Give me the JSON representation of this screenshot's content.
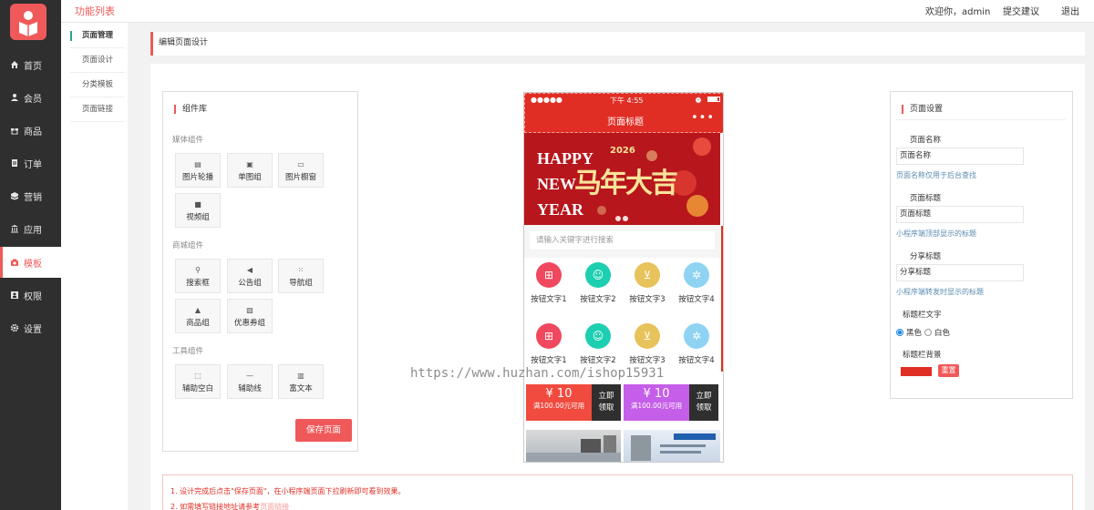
{
  "header": {
    "title": "功能列表",
    "welcome": "欢迎你，admin",
    "feedback": "提交建议",
    "logout": "退出"
  },
  "sidebar": {
    "items": [
      {
        "label": "首页",
        "icon": "home-icon"
      },
      {
        "label": "会员",
        "icon": "user-icon"
      },
      {
        "label": "商品",
        "icon": "gift-icon"
      },
      {
        "label": "订单",
        "icon": "order-icon"
      },
      {
        "label": "营销",
        "icon": "marketing-icon"
      },
      {
        "label": "应用",
        "icon": "bank-icon"
      },
      {
        "label": "模板",
        "icon": "camera-icon",
        "active": true
      },
      {
        "label": "权限",
        "icon": "permission-icon"
      },
      {
        "label": "设置",
        "icon": "gear-icon"
      }
    ]
  },
  "subnav": {
    "items": [
      "页面管理",
      "页面设计",
      "分类模板",
      "页面链接"
    ]
  },
  "page": {
    "heading": "编辑页面设计"
  },
  "library": {
    "title": "组件库",
    "groups": [
      {
        "label": "媒体组件",
        "items": [
          {
            "label": "图片轮播",
            "icon": "image-carousel-icon"
          },
          {
            "label": "单图组",
            "icon": "image-icon"
          },
          {
            "label": "图片橱窗",
            "icon": "window-icon"
          },
          {
            "label": "视频组",
            "icon": "video-icon"
          }
        ]
      },
      {
        "label": "商城组件",
        "items": [
          {
            "label": "搜索框",
            "icon": "search-icon"
          },
          {
            "label": "公告组",
            "icon": "announcement-icon"
          },
          {
            "label": "导航组",
            "icon": "grid-icon"
          },
          {
            "label": "商品组",
            "icon": "bag-icon"
          },
          {
            "label": "优惠券组",
            "icon": "coupon-icon"
          }
        ]
      },
      {
        "label": "工具组件",
        "items": [
          {
            "label": "辅助空白",
            "icon": "blank-icon"
          },
          {
            "label": "辅助线",
            "icon": "line-icon"
          },
          {
            "label": "富文本",
            "icon": "clipboard-icon"
          }
        ]
      }
    ],
    "save_label": "保存页面"
  },
  "phone": {
    "status_signal": "●●●●●",
    "status_time": "下午 4:55",
    "title": "页面标题",
    "menu": "•••",
    "banner": {
      "line1": "HAPPY",
      "line2": "NEW",
      "line3": "YEAR",
      "main": "马年大吉",
      "year": "2026"
    },
    "search_placeholder": "请输入关键字进行搜索",
    "nav_buttons": [
      {
        "label": "按钮文字1",
        "color": "#f0485e"
      },
      {
        "label": "按钮文字2",
        "color": "#1ccfb0"
      },
      {
        "label": "按钮文字3",
        "color": "#e8c25a"
      },
      {
        "label": "按钮文字4",
        "color": "#8fd3f2"
      },
      {
        "label": "按钮文字1",
        "color": "#f0485e"
      },
      {
        "label": "按钮文字2",
        "color": "#1ccfb0"
      },
      {
        "label": "按钮文字3",
        "color": "#e8c25a"
      },
      {
        "label": "按钮文字4",
        "color": "#8fd3f2"
      }
    ],
    "coupons": [
      {
        "amount": "¥ 10",
        "condition": "满100.00元可用",
        "action1": "立即",
        "action2": "领取",
        "color": "#f04b3e"
      },
      {
        "amount": "¥ 10",
        "condition": "满100.00元可用",
        "action1": "立即",
        "action2": "领取",
        "color": "#c55ee8"
      }
    ]
  },
  "settings": {
    "title": "页面设置",
    "page_name_label": "页面名称",
    "page_name_value": "页面名称",
    "page_name_help": "页面名称仅用于后台查找",
    "page_title_label": "页面标题",
    "page_title_value": "页面标题",
    "page_title_help": "小程序端顶部显示的标题",
    "share_label": "分享标题",
    "share_value": "分享标题",
    "share_help": "小程序端转发时显示的标题",
    "titlebar_text_label": "标题栏文字",
    "option_black": "黑色",
    "option_white": "白色",
    "titlebar_bg_label": "标题栏背景",
    "bg_color": "#e02e24",
    "reset_label": "重置"
  },
  "notice": {
    "line1": "1. 设计完成后点击\"保存页面\"，在小程序端页面下拉刷新即可看到效果。",
    "line2_prefix": "2. 如需填写链接地址请参考",
    "line2_link": "页面链接"
  },
  "watermark": "https://www.huzhan.com/ishop15931"
}
